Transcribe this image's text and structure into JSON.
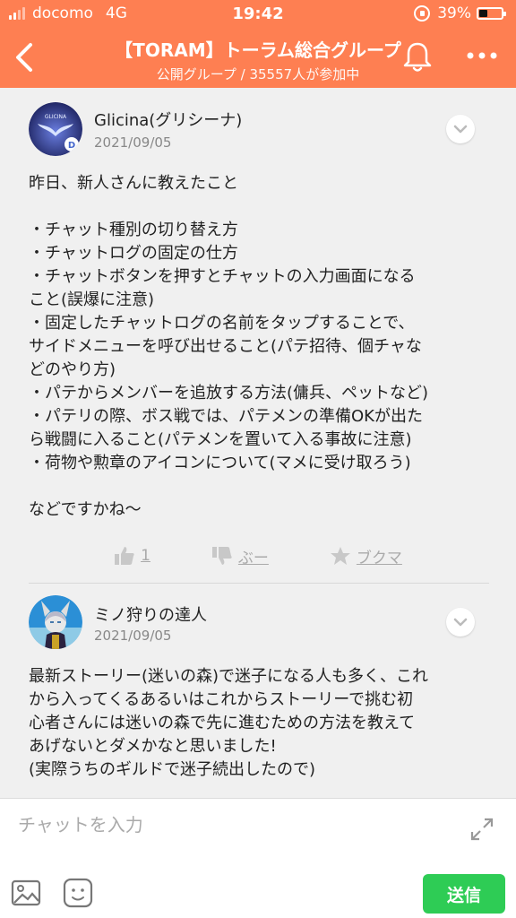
{
  "status_bar": {
    "carrier": "docomo",
    "network": "4G",
    "time": "19:42",
    "battery": "39%"
  },
  "header": {
    "title": "【TORAM】トーラム総合グループ",
    "subtitle": "公開グループ / 35557人が参加中",
    "back_icon": "chevron-left-icon",
    "bell_icon": "bell-icon",
    "more_icon": "more-dots-icon",
    "color": "#fe7f52"
  },
  "posts": [
    {
      "author": "Glicina(グリシーナ)",
      "date": "2021/09/05",
      "avatar_text": "GLICINA",
      "body": "昨日、新人さんに教えたこと\n\n・チャット種別の切り替え方\n・チャットログの固定の仕方\n・チャットボタンを押すとチャットの入力画面になる\nこと(誤爆に注意)\n・固定したチャットログの名前をタップすることで、\nサイドメニューを呼び出せること(パテ招待、個チャな\nどのやり方)\n・パテからメンバーを追放する方法(傭兵、ペットなど)\n・パテリの際、ボス戦では、パテメンの準備OKが出た\nら戦闘に入ること(パテメンを置いて入る事故に注意)\n・荷物や勲章のアイコンについて(マメに受け取ろう)\n\nなどですかね〜",
      "actions": {
        "like_count": "1",
        "dislike_label": "ぶー",
        "bookmark_label": "ブクマ"
      }
    },
    {
      "author": "ミノ狩りの達人",
      "date": "2021/09/05",
      "body": "最新ストーリー(迷いの森)で迷子になる人も多く、これ\nから入ってくるあるいはこれからストーリーで挑む初\n心者さんには迷いの森で先に進むための方法を教えて\nあげないとダメかなと思いました!\n(実際うちのギルドで迷子続出したので)"
    }
  ],
  "input": {
    "placeholder": "チャットを入力",
    "send_label": "送信",
    "send_color": "#2ecc55"
  }
}
